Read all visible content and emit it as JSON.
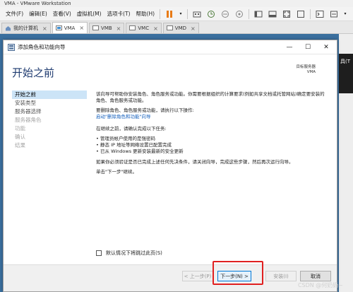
{
  "vmware": {
    "title": "VMA - VMware Workstation",
    "menu": [
      {
        "label": "文件(F)"
      },
      {
        "label": "编辑(E)"
      },
      {
        "label": "查看(V)"
      },
      {
        "label": "虚拟机(M)"
      },
      {
        "label": "选项卡(T)"
      },
      {
        "label": "帮助(H)"
      }
    ],
    "tabs": [
      {
        "label": "我的计算机",
        "icon": "home-icon",
        "active": false
      },
      {
        "label": "VMA",
        "icon": "vm-icon",
        "active": true
      },
      {
        "label": "VMB",
        "icon": "vm-icon",
        "active": false
      },
      {
        "label": "VMC",
        "icon": "vm-icon",
        "active": false
      },
      {
        "label": "VMD",
        "icon": "vm-icon",
        "active": false
      }
    ],
    "behind_text": "具(T"
  },
  "wizard": {
    "window_title": "添加角色和功能向导",
    "heading": "开始之前",
    "target_label": "目标服务器",
    "target_value": "VMA",
    "nav": [
      {
        "label": "开始之前",
        "state": "active"
      },
      {
        "label": "安装类型",
        "state": "normal"
      },
      {
        "label": "服务器选择",
        "state": "normal"
      },
      {
        "label": "服务器角色",
        "state": "disabled"
      },
      {
        "label": "功能",
        "state": "disabled"
      },
      {
        "label": "确认",
        "state": "disabled"
      },
      {
        "label": "结果",
        "state": "disabled"
      }
    ],
    "content": {
      "para1": "该向导可帮助你安装角色、角色服务或功能。你需要根据组织的计算要求(例如共享文档或托管网站)确定要安装的角色、角色服务或功能。",
      "para2": "要删除角色、角色服务或功能，请执行以下操作:",
      "remove_link": "启动\"删除角色和功能\"向导",
      "para3": "在继续之前，请确认完成以下任务:",
      "tasks": [
        "管理员帐户使用的是强密码",
        "静态 IP 地址等网络设置已配置完成",
        "已从 Windows 更新安装最新的安全更新"
      ],
      "para4": "如果你必须验证是否已完成上述任何先决条件，请关闭向导，完成这些步骤，然后再次运行向导。",
      "para5": "单击\"下一步\"继续。"
    },
    "skip_label": "默认情况下将跳过此页(S)",
    "buttons": {
      "prev": "< 上一步(P)",
      "next": "下一步(N) >",
      "install": "安装(I)",
      "cancel": "取消"
    }
  },
  "watermark": "CSDN @何奶奶~"
}
